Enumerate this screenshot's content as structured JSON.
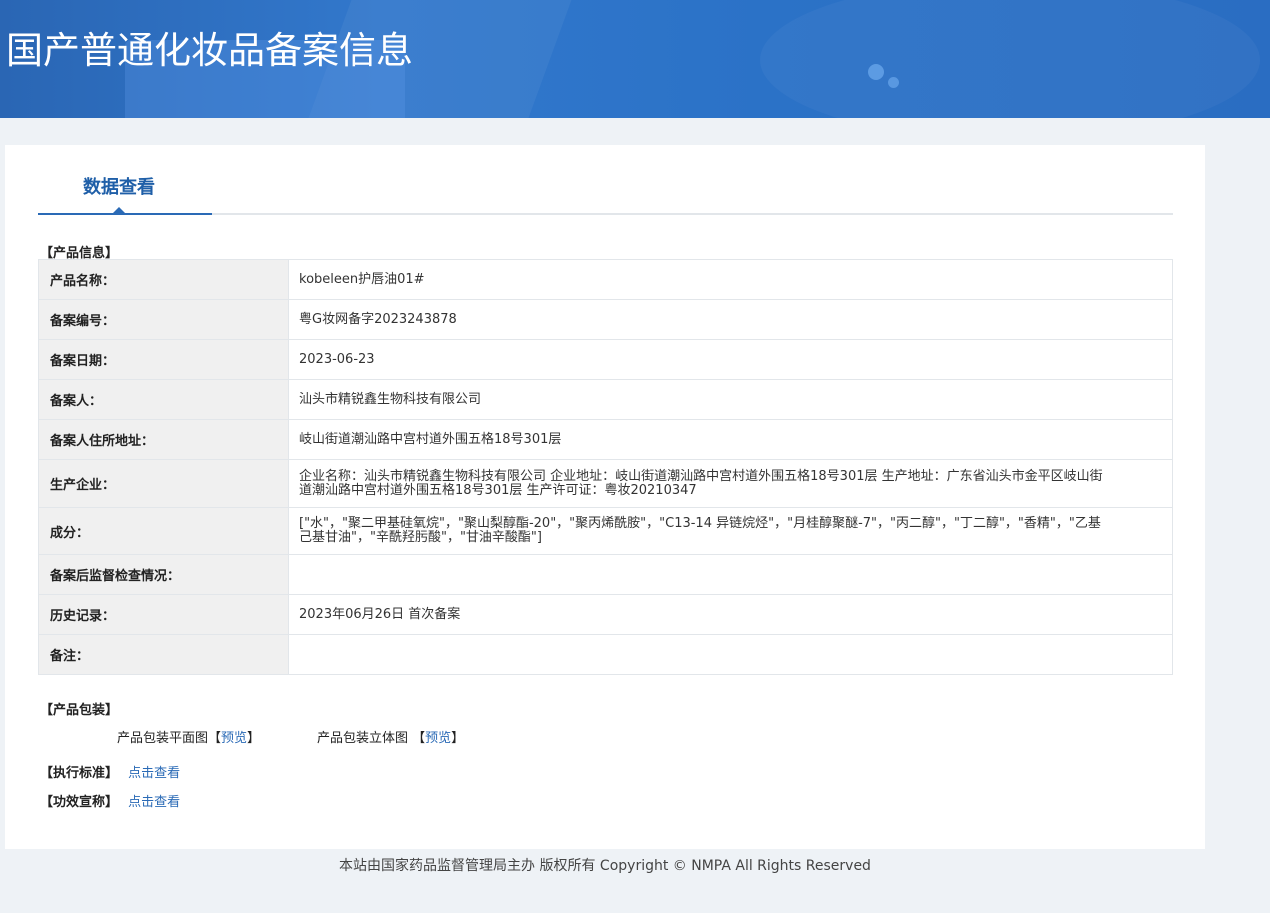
{
  "header": {
    "title": "国产普通化妆品备案信息"
  },
  "tabs": [
    {
      "label": "数据查看"
    }
  ],
  "product_info": {
    "section_title": "【产品信息】",
    "rows": [
      {
        "label": "产品名称：",
        "value": "kobeleen护唇油01#"
      },
      {
        "label": "备案编号：",
        "value": "粤G妆网备字2023243878"
      },
      {
        "label": "备案日期：",
        "value": "2023-06-23"
      },
      {
        "label": "备案人：",
        "value": "汕头市精锐鑫生物科技有限公司"
      },
      {
        "label": "备案人住所地址：",
        "value": "岐山街道潮汕路中宫村道外围五格18号301层"
      },
      {
        "label": "生产企业：",
        "value": "企业名称：汕头市精锐鑫生物科技有限公司 企业地址：岐山街道潮汕路中宫村道外围五格18号301层 生产地址：广东省汕头市金平区岐山街道潮汕路中宫村道外围五格18号301层 生产许可证：粤妆20210347"
      },
      {
        "label": "成分：",
        "value": "[\"水\"，\"聚二甲基硅氧烷\"，\"聚山梨醇酯-20\"，\"聚丙烯酰胺\"，\"C13-14 异链烷烃\"，\"月桂醇聚醚-7\"，\"丙二醇\"，\"丁二醇\"，\"香精\"，\"乙基己基甘油\"，\"辛酰羟肟酸\"，\"甘油辛酸酯\"]"
      },
      {
        "label": "备案后监督检查情况：",
        "value": ""
      },
      {
        "label": "历史记录：",
        "value": "2023年06月26日 首次备案"
      },
      {
        "label": "备注：",
        "value": ""
      }
    ]
  },
  "packaging": {
    "section_title": "【产品包装】",
    "flat_label": "产品包装平面图",
    "flat_link": "预览",
    "solid_label": "产品包装立体图",
    "solid_link": "预览"
  },
  "standard": {
    "label": "【执行标准】",
    "link": "点击查看"
  },
  "efficacy": {
    "label": "【功效宣称】",
    "link": "点击查看"
  },
  "footer": {
    "text": "本站由国家药品监督管理局主办 版权所有 Copyright © NMPA All Rights Reserved"
  }
}
